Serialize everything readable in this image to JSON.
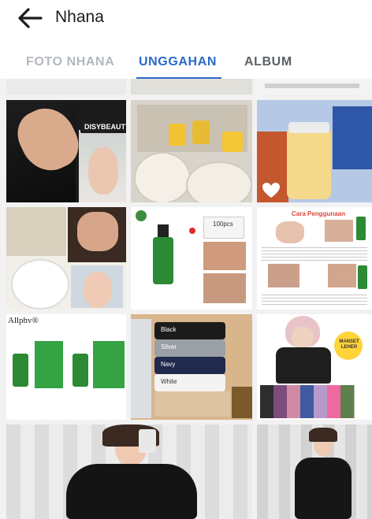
{
  "header": {
    "title": "Nhana"
  },
  "tabs": [
    {
      "label": "FOTO NHANA"
    },
    {
      "label": "UNGGAHAN"
    },
    {
      "label": "ALBUM"
    }
  ],
  "posts": {
    "p1_label": "DISYBEAUTY",
    "p5_label": "100pcs",
    "p6_title": "Cara Penggunaan",
    "p7_brand": "Allphv®",
    "p8_labels": [
      "Black",
      "Silver",
      "Navy",
      "White"
    ],
    "p9_badge": "MANSET LEHER"
  },
  "colors": {
    "accent": "#2a68c9",
    "inactive": "#b3b8be",
    "text": "#1c1c1c"
  }
}
